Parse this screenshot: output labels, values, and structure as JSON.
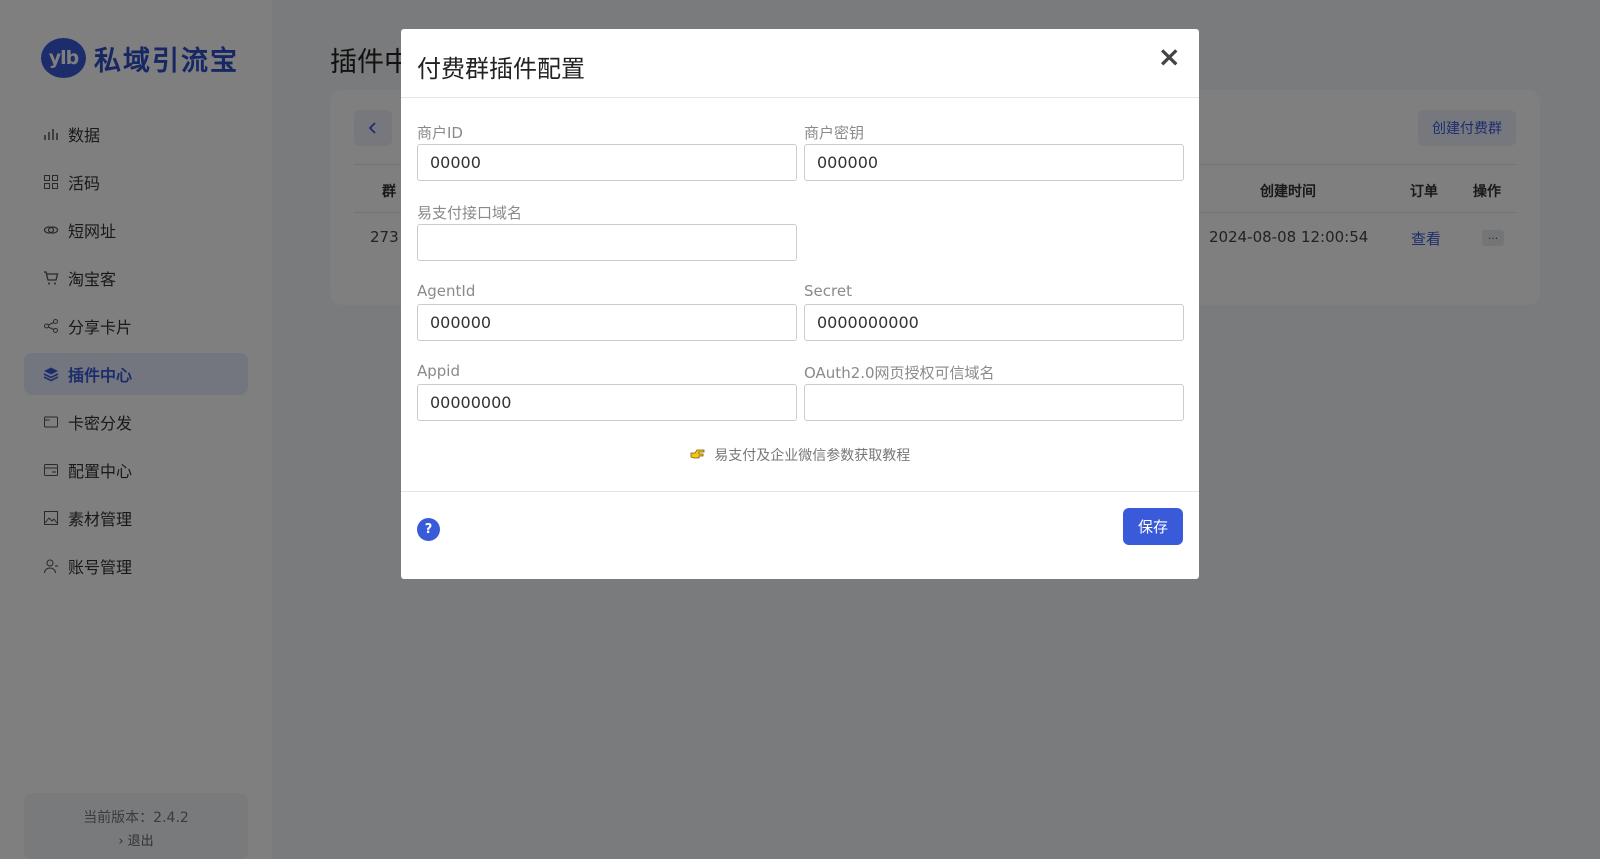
{
  "app": {
    "logo_badge": "ylb",
    "logo_text": "私域引流宝"
  },
  "sidebar": {
    "items": [
      {
        "label": "数据",
        "icon": "bar-chart-icon"
      },
      {
        "label": "活码",
        "icon": "grid-icon"
      },
      {
        "label": "短网址",
        "icon": "link-icon"
      },
      {
        "label": "淘宝客",
        "icon": "cart-icon"
      },
      {
        "label": "分享卡片",
        "icon": "share-icon"
      },
      {
        "label": "插件中心",
        "icon": "layers-icon"
      },
      {
        "label": "卡密分发",
        "icon": "card-icon"
      },
      {
        "label": "配置中心",
        "icon": "config-icon"
      },
      {
        "label": "素材管理",
        "icon": "image-icon"
      },
      {
        "label": "账号管理",
        "icon": "user-icon"
      }
    ],
    "active": "插件中心",
    "version_text": "当前版本：2.4.2",
    "logout_label": "› 退出"
  },
  "main": {
    "page_title": "插件中",
    "create_button": "创建付费群",
    "table": {
      "headers": {
        "group": "群",
        "created": "创建时间",
        "orders": "订单",
        "actions": "操作"
      },
      "row": {
        "id": "273",
        "created": "2024-08-08 12:00:54",
        "orders_link": "查看",
        "more": "···"
      }
    }
  },
  "modal": {
    "title": "付费群插件配置",
    "close": "×",
    "fields": {
      "merchant_id": {
        "label": "商户ID",
        "value": "00000"
      },
      "merchant_key": {
        "label": "商户密钥",
        "value": "000000"
      },
      "pay_domain": {
        "label": "易支付接口域名",
        "value": ""
      },
      "agent_id": {
        "label": "AgentId",
        "value": "000000"
      },
      "secret": {
        "label": "Secret",
        "value": "0000000000"
      },
      "appid": {
        "label": "Appid",
        "value": "00000000"
      },
      "oauth_domain": {
        "label": "OAuth2.0网页授权可信域名",
        "value": ""
      }
    },
    "tutorial_text": "易支付及企业微信参数获取教程",
    "help": "?",
    "save_label": "保存"
  },
  "colors": {
    "accent": "#3a5bd9",
    "overlay": "rgba(0,0,0,0.5)"
  }
}
